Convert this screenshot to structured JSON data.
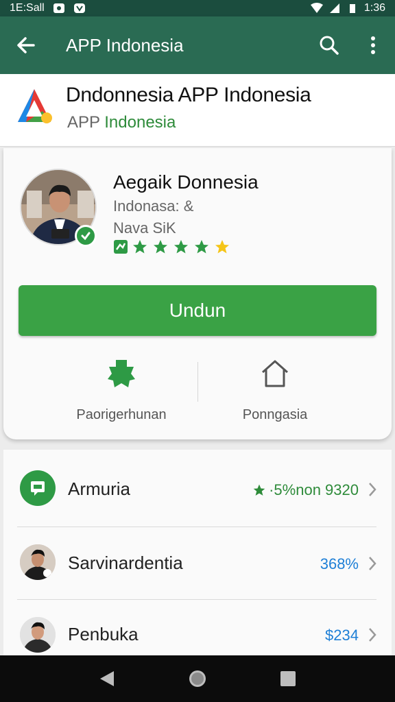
{
  "status_bar": {
    "left_text": "1E:Sall",
    "time": "1:36"
  },
  "app_bar": {
    "title": "APP Indonesia"
  },
  "app_header": {
    "name": "Dndonnesia APP Indonesia",
    "sub_a": "APP",
    "sub_b": "Indonesia"
  },
  "developer": {
    "name": "Aegaik Donnesia",
    "line1": "Indonasa: &",
    "line2": "Nava SiK",
    "rating_stars": 4
  },
  "install_button": {
    "label": "Undun"
  },
  "actions": [
    {
      "label": "Paorigerhunan"
    },
    {
      "label": "Ponngasia"
    }
  ],
  "list": [
    {
      "label": "Armuria",
      "value": "·5%non 9320",
      "value_color": "#2e8b3a"
    },
    {
      "label": "Sarvinardentia",
      "value": "368%",
      "value_color": "#1e7fd6"
    },
    {
      "label": "Penbuka",
      "value": "$234",
      "value_color": "#1e7fd6"
    }
  ],
  "colors": {
    "appbar": "#2a6b53",
    "status": "#1b4d3e",
    "accent_green": "#3aa245",
    "star_gold": "#f5c518"
  }
}
